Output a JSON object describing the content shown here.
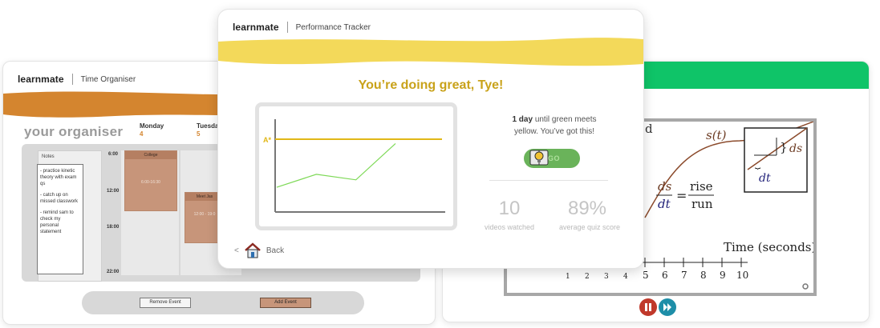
{
  "organiser": {
    "brand": "learnmate",
    "subtitle": "Time Organiser",
    "title": "your organiser",
    "accent_color": "#d4852f",
    "days": [
      {
        "name": "Monday",
        "num": "4"
      },
      {
        "name": "Tuesda",
        "num": "5"
      }
    ],
    "notes_title": "Notes",
    "notes": [
      "- practice kinetic theory with exam qs",
      "- catch up on missed classwork",
      "- remind sam to check my personal statement"
    ],
    "times": [
      "6:00",
      "12:00",
      "18:00",
      "22:00"
    ],
    "events": [
      {
        "title": "College",
        "time": "6:00-16:30"
      },
      {
        "title": "Meet Jas",
        "time": "12:00 - 19:0"
      }
    ],
    "remove_btn": "Remove Event",
    "add_btn": "Add Event"
  },
  "tracker": {
    "brand": "learnmate",
    "subtitle": "Performance Tracker",
    "band_color": "#f3d95a",
    "headline": "You’re doing great, Tye!",
    "graph": {
      "target_label": "A*",
      "target_color": "#e1b717",
      "progress_color": "#7ed957",
      "progress": [
        {
          "x": 0,
          "y": 0.22
        },
        {
          "x": 1,
          "y": 0.43
        },
        {
          "x": 2,
          "y": 0.34
        },
        {
          "x": 3,
          "y": 0.93
        }
      ]
    },
    "info_bold": "1 day",
    "info_rest": "until green meets",
    "info_line2": "yellow. You’ve got this!",
    "go_label": "GO",
    "stats": [
      {
        "value": "10",
        "label": "videos watched"
      },
      {
        "value": "89%",
        "label": "average quiz score"
      }
    ],
    "back_label": "Back"
  },
  "video": {
    "top_color": "#0fc468",
    "partial_word": "d",
    "curve_label": "s(t)",
    "ds_label": "ds",
    "dt_label": "dt",
    "fraction_top": "ds",
    "fraction_bottom": "dt",
    "equals": "=",
    "rise": "rise",
    "run": "run",
    "axis_label": "Time (seconds)",
    "ticks": [
      "1",
      "2",
      "3",
      "4",
      "5",
      "6",
      "7",
      "8",
      "9",
      "10"
    ]
  }
}
